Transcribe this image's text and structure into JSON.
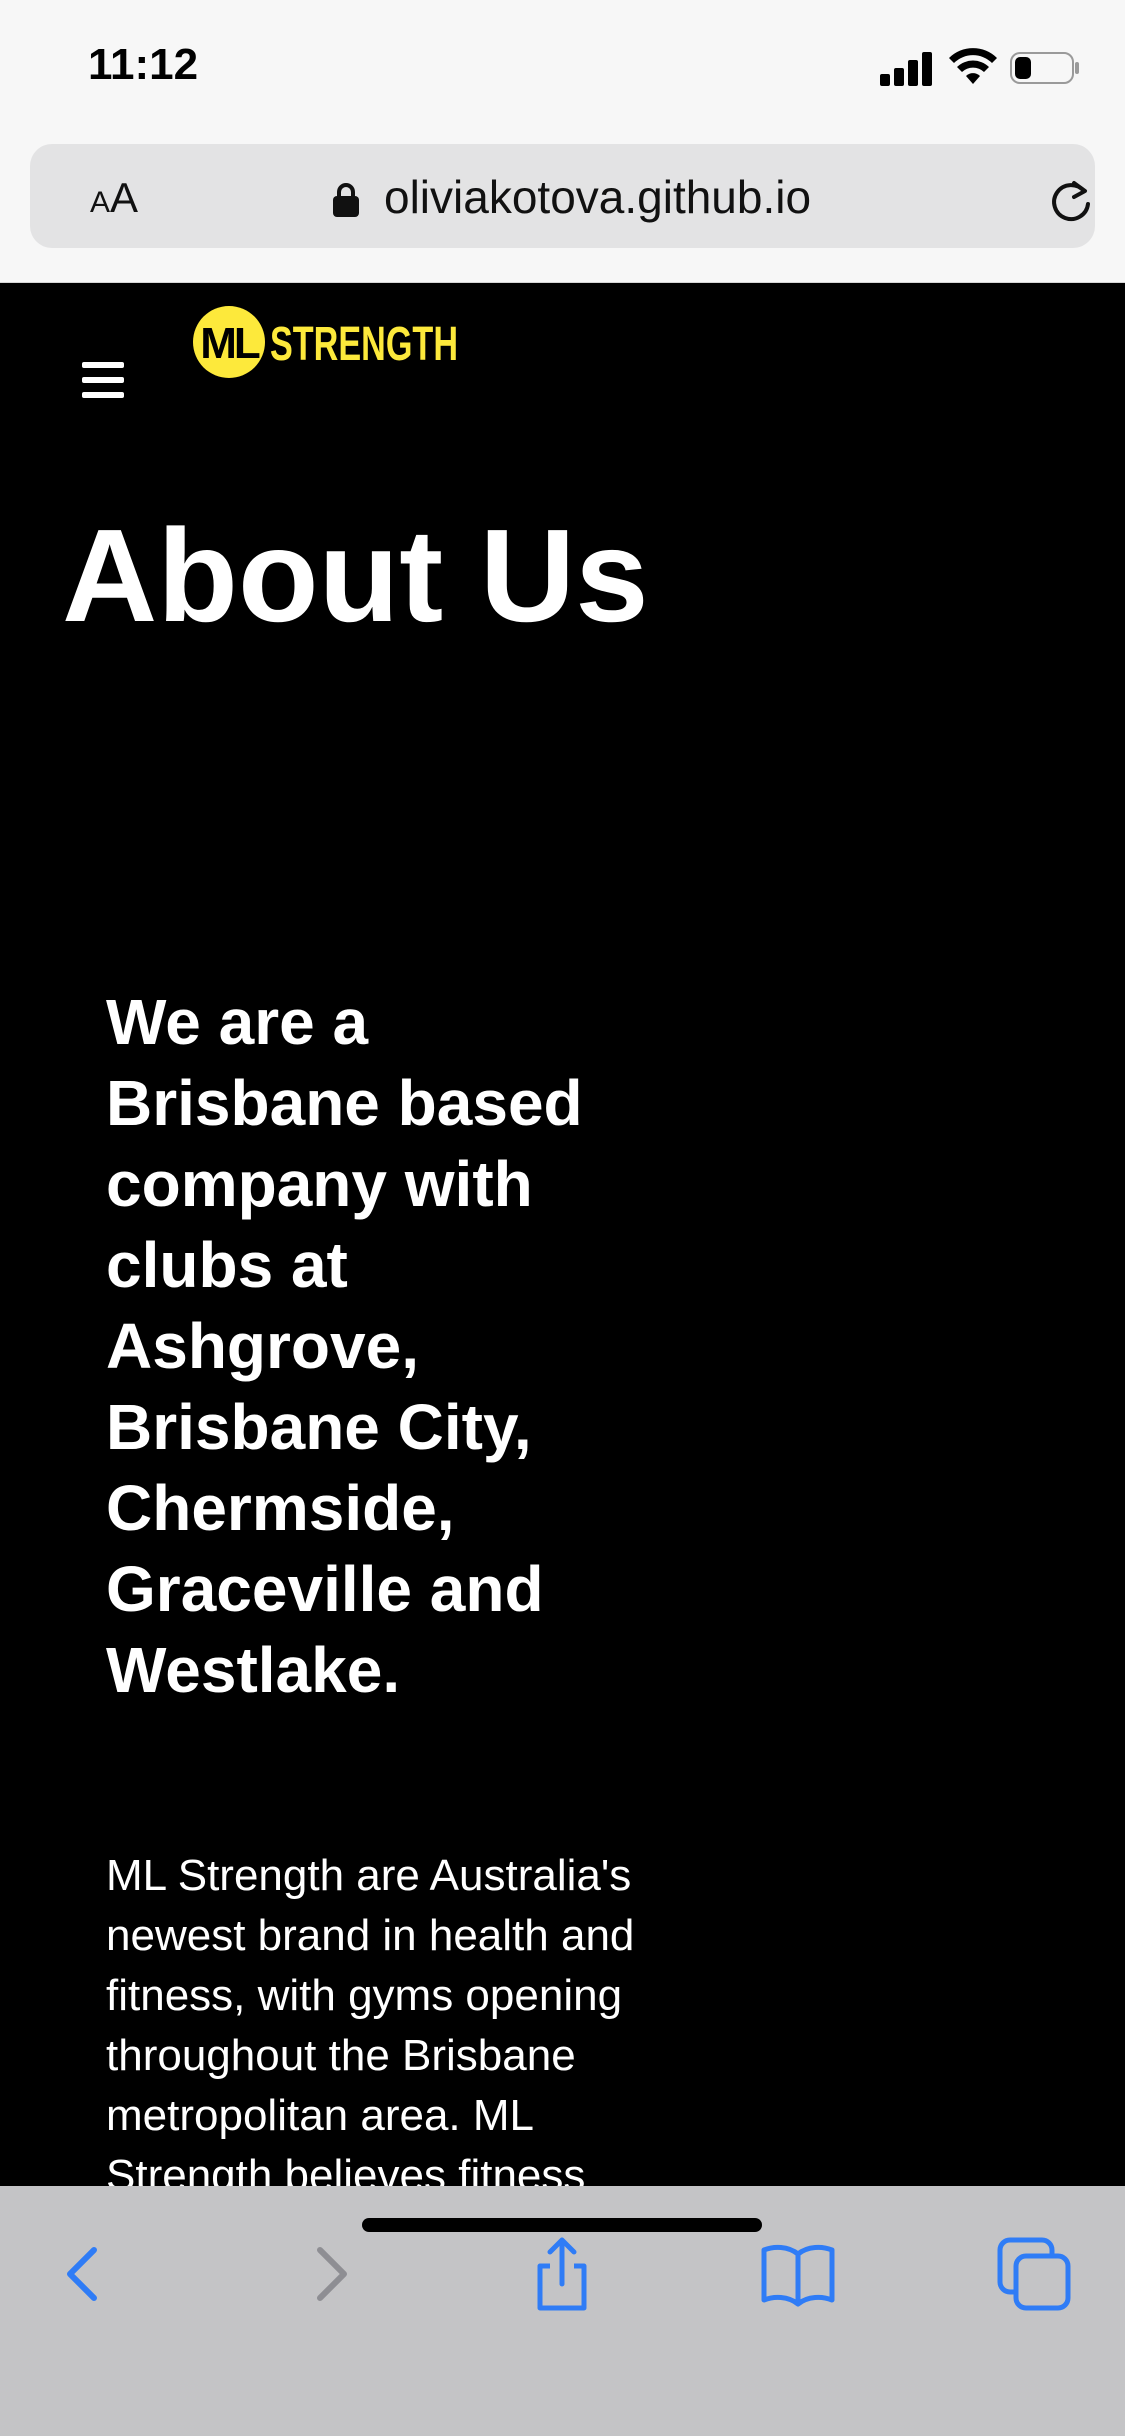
{
  "status_bar": {
    "time": "11:12",
    "icons": [
      "cellular-signal-icon",
      "wifi-icon",
      "battery-icon"
    ],
    "battery_level": 0.25
  },
  "browser": {
    "text_size_label_small": "A",
    "text_size_label_big": "A",
    "url": "oliviakotova.github.io",
    "icons": [
      "lock-icon",
      "reload-icon"
    ]
  },
  "site": {
    "logo_text": "ML STRENGTH",
    "logo_monogram": "ML",
    "logo_word": "STRENGTH",
    "page_title": "About Us",
    "headline": "We are a Brisbane based company with clubs at Ashgrove, Brisbane City, Chermside, Graceville and Westlake.",
    "body": "ML Strength are Australia's newest brand in health and fitness, with gyms opening throughout the Brisbane metropolitan area. ML Strength believes fitness"
  },
  "toolbar": {
    "buttons": [
      "back-icon",
      "forward-icon",
      "share-icon",
      "bookmarks-icon",
      "tabs-icon"
    ]
  },
  "colors": {
    "brand_yellow": "#fde93b",
    "page_background": "#000000",
    "toolbar_blue": "#2f7cf6",
    "toolbar_background": "#c4c4c6"
  }
}
